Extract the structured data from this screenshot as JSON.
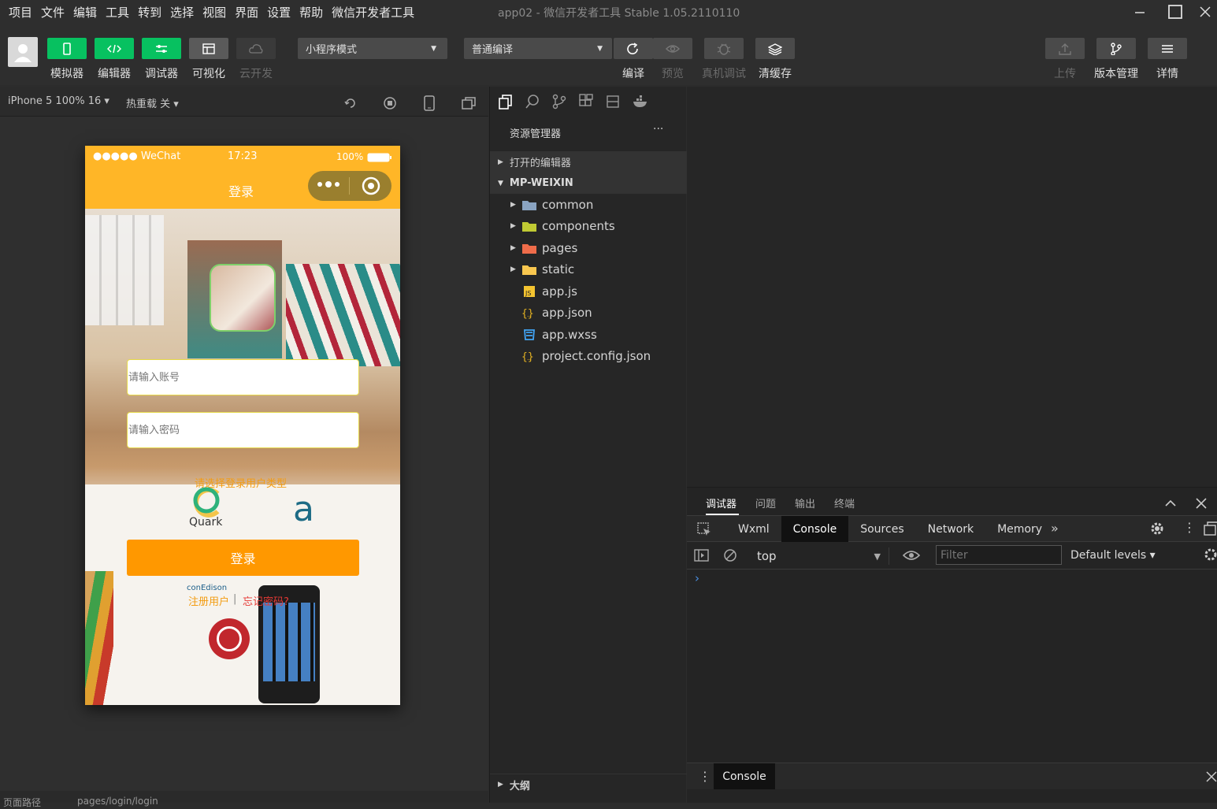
{
  "menu": [
    "项目",
    "文件",
    "编辑",
    "工具",
    "转到",
    "选择",
    "视图",
    "界面",
    "设置",
    "帮助",
    "微信开发者工具"
  ],
  "window_title": "app02 - 微信开发者工具 Stable 1.05.2110110",
  "toolbar": {
    "left_buttons": [
      {
        "label": "模拟器",
        "icon": "phone-icon",
        "color": "#07c160"
      },
      {
        "label": "编辑器",
        "icon": "code-icon",
        "color": "#07c160"
      },
      {
        "label": "调试器",
        "icon": "debug-sliders-icon",
        "color": "#07c160"
      },
      {
        "label": "可视化",
        "icon": "layout-icon",
        "color": "#5a5a5a"
      },
      {
        "label": "云开发",
        "icon": "cloud-icon",
        "color": "#3a3a3a"
      }
    ],
    "mode_select": "小程序模式",
    "compile_select": "普通编译",
    "mid_buttons": [
      {
        "label": "编译",
        "icon": "refresh-icon"
      },
      {
        "label": "预览",
        "icon": "eye-icon"
      },
      {
        "label": "真机调试",
        "icon": "bug-icon"
      },
      {
        "label": "清缓存",
        "icon": "layers-icon"
      }
    ],
    "right_buttons": [
      {
        "label": "上传",
        "icon": "upload-icon"
      },
      {
        "label": "版本管理",
        "icon": "branch-icon"
      },
      {
        "label": "详情",
        "icon": "menu-icon"
      }
    ]
  },
  "simulator": {
    "device": "iPhone 5 100% 16 ▾",
    "hotreload": "热重载 关 ▾",
    "status_left": "●●●●● WeChat",
    "status_time": "17:23",
    "status_battery": "100%",
    "nav_title": "登录",
    "account_placeholder": "请输入账号",
    "password_placeholder": "请输入密码",
    "user_type_prompt": "请选择登录用户类型",
    "login_button": "登录",
    "register_link": "注册用户",
    "separator": "|",
    "forgot_link": "忘记密码?"
  },
  "statusbar": {
    "path_label": "页面路径",
    "path": "pages/login/login"
  },
  "explorer": {
    "title": "资源管理器",
    "more": "···",
    "open_editors": "打开的编辑器",
    "project": "MP-WEIXIN",
    "files": [
      {
        "name": "common",
        "icon": "folder-icon",
        "color": "#8aa4c2",
        "folder": true
      },
      {
        "name": "components",
        "icon": "folder-components-icon",
        "color": "#c0ca33",
        "folder": true
      },
      {
        "name": "pages",
        "icon": "folder-pages-icon",
        "color": "#ef6c4a",
        "folder": true
      },
      {
        "name": "static",
        "icon": "folder-static-icon",
        "color": "#f9c74f",
        "folder": true
      },
      {
        "name": "app.js",
        "icon": "js-file-icon",
        "color": "#f4c430",
        "folder": false
      },
      {
        "name": "app.json",
        "icon": "json-file-icon",
        "color": "#e6b422",
        "folder": false
      },
      {
        "name": "app.wxss",
        "icon": "css-file-icon",
        "color": "#42a5f5",
        "folder": false
      },
      {
        "name": "project.config.json",
        "icon": "json-file-icon",
        "color": "#e6b422",
        "folder": false
      }
    ],
    "outline": "大纲"
  },
  "devtools": {
    "top_tabs": [
      "调试器",
      "问题",
      "输出",
      "终端"
    ],
    "tabs": [
      "Wxml",
      "Console",
      "Sources",
      "Network",
      "Memory"
    ],
    "active_tab": "Console",
    "context": "top",
    "filter_placeholder": "Filter",
    "levels": "Default levels ▾",
    "prompt": "›",
    "drawer_tab": "Console"
  }
}
